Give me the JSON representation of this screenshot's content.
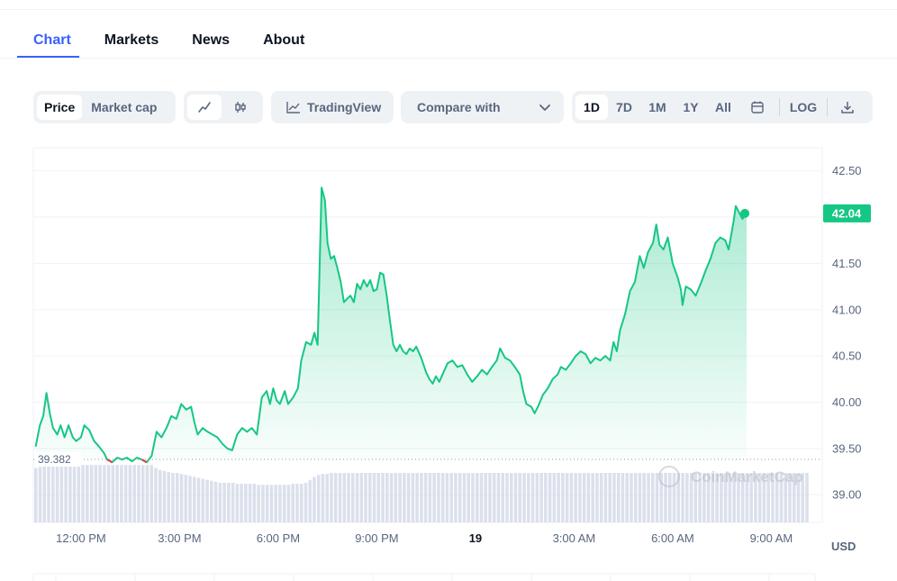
{
  "tabs": [
    {
      "label": "Chart",
      "active": true
    },
    {
      "label": "Markets",
      "active": false
    },
    {
      "label": "News",
      "active": false
    },
    {
      "label": "About",
      "active": false
    }
  ],
  "toolbar": {
    "type_toggle": [
      {
        "label": "Price",
        "active": true
      },
      {
        "label": "Market cap",
        "active": false
      }
    ],
    "chart_style": [
      {
        "icon": "line-chart-icon",
        "active": true
      },
      {
        "icon": "candlestick-icon",
        "active": false
      }
    ],
    "tradingview_label": "TradingView",
    "compare_label": "Compare with",
    "ranges": [
      {
        "label": "1D",
        "active": true
      },
      {
        "label": "7D",
        "active": false
      },
      {
        "label": "1M",
        "active": false
      },
      {
        "label": "1Y",
        "active": false
      },
      {
        "label": "All",
        "active": false
      }
    ],
    "calendar_icon": "calendar-icon",
    "log_label": "LOG",
    "download_icon": "download-icon"
  },
  "colors": {
    "accent": "#3861fb",
    "line_up": "#16c784",
    "line_down": "#ea3943",
    "volume": "#cfd6e4",
    "grid": "#eff2f5"
  },
  "chart_data": {
    "type": "area",
    "currency": "USD",
    "current_price_label": "42.04",
    "baseline_label": "39.382",
    "watermark": "CoinMarketCap",
    "y_ticks": [
      "42.50",
      "42.00",
      "41.50",
      "41.00",
      "40.50",
      "40.00",
      "39.50",
      "39.00"
    ],
    "x_ticks": [
      {
        "label": "12:00 PM",
        "h": 0,
        "bold": false
      },
      {
        "label": "3:00 PM",
        "h": 3,
        "bold": false
      },
      {
        "label": "6:00 PM",
        "h": 6,
        "bold": false
      },
      {
        "label": "9:00 PM",
        "h": 9,
        "bold": false
      },
      {
        "label": "19",
        "h": 12,
        "bold": true
      },
      {
        "label": "3:00 AM",
        "h": 15,
        "bold": false
      },
      {
        "label": "6:00 AM",
        "h": 18,
        "bold": false
      },
      {
        "label": "9:00 AM",
        "h": 21,
        "bold": false
      }
    ],
    "ylim": [
      38.7,
      42.75
    ],
    "xlim": [
      -1.45,
      22.55
    ],
    "baseline": 39.382,
    "series": [
      {
        "points": [
          [
            -1.38,
            39.52
          ],
          [
            -1.25,
            39.75
          ],
          [
            -1.15,
            39.85
          ],
          [
            -1.05,
            40.1
          ],
          [
            -0.95,
            39.88
          ],
          [
            -0.85,
            39.72
          ],
          [
            -0.72,
            39.65
          ],
          [
            -0.62,
            39.75
          ],
          [
            -0.5,
            39.62
          ],
          [
            -0.38,
            39.75
          ],
          [
            -0.25,
            39.62
          ],
          [
            -0.15,
            39.58
          ],
          [
            0.0,
            39.62
          ],
          [
            0.1,
            39.75
          ],
          [
            0.25,
            39.7
          ],
          [
            0.4,
            39.58
          ],
          [
            0.55,
            39.52
          ],
          [
            0.7,
            39.45
          ],
          [
            0.8,
            39.38
          ],
          [
            0.95,
            39.35
          ],
          [
            1.1,
            39.4
          ],
          [
            1.25,
            39.38
          ],
          [
            1.4,
            39.4
          ],
          [
            1.55,
            39.36
          ],
          [
            1.7,
            39.4
          ],
          [
            1.85,
            39.38
          ],
          [
            2.0,
            39.35
          ],
          [
            2.15,
            39.42
          ],
          [
            2.3,
            39.68
          ],
          [
            2.45,
            39.62
          ],
          [
            2.6,
            39.72
          ],
          [
            2.75,
            39.85
          ],
          [
            2.9,
            39.82
          ],
          [
            3.05,
            39.98
          ],
          [
            3.2,
            39.92
          ],
          [
            3.35,
            39.95
          ],
          [
            3.45,
            39.78
          ],
          [
            3.55,
            39.65
          ],
          [
            3.7,
            39.72
          ],
          [
            3.85,
            39.68
          ],
          [
            4.0,
            39.65
          ],
          [
            4.15,
            39.62
          ],
          [
            4.3,
            39.55
          ],
          [
            4.45,
            39.5
          ],
          [
            4.6,
            39.48
          ],
          [
            4.75,
            39.65
          ],
          [
            4.9,
            39.72
          ],
          [
            5.05,
            39.68
          ],
          [
            5.2,
            39.72
          ],
          [
            5.35,
            39.65
          ],
          [
            5.5,
            40.05
          ],
          [
            5.65,
            40.12
          ],
          [
            5.75,
            39.98
          ],
          [
            5.85,
            40.15
          ],
          [
            5.95,
            40.02
          ],
          [
            6.05,
            39.98
          ],
          [
            6.2,
            40.12
          ],
          [
            6.3,
            39.98
          ],
          [
            6.45,
            40.05
          ],
          [
            6.6,
            40.15
          ],
          [
            6.7,
            40.45
          ],
          [
            6.85,
            40.65
          ],
          [
            7.0,
            40.62
          ],
          [
            7.1,
            40.75
          ],
          [
            7.2,
            40.62
          ],
          [
            7.32,
            42.32
          ],
          [
            7.42,
            42.18
          ],
          [
            7.5,
            41.72
          ],
          [
            7.6,
            41.55
          ],
          [
            7.7,
            41.58
          ],
          [
            7.8,
            41.45
          ],
          [
            7.9,
            41.3
          ],
          [
            8.0,
            41.08
          ],
          [
            8.1,
            41.12
          ],
          [
            8.2,
            41.15
          ],
          [
            8.3,
            41.08
          ],
          [
            8.4,
            41.28
          ],
          [
            8.5,
            41.22
          ],
          [
            8.6,
            41.32
          ],
          [
            8.7,
            41.25
          ],
          [
            8.8,
            41.32
          ],
          [
            8.9,
            41.2
          ],
          [
            9.0,
            41.22
          ],
          [
            9.1,
            41.4
          ],
          [
            9.2,
            41.38
          ],
          [
            9.3,
            41.15
          ],
          [
            9.4,
            40.88
          ],
          [
            9.5,
            40.62
          ],
          [
            9.6,
            40.55
          ],
          [
            9.7,
            40.62
          ],
          [
            9.8,
            40.55
          ],
          [
            9.9,
            40.52
          ],
          [
            10.0,
            40.58
          ],
          [
            10.1,
            40.55
          ],
          [
            10.2,
            40.6
          ],
          [
            10.35,
            40.48
          ],
          [
            10.5,
            40.32
          ],
          [
            10.6,
            40.25
          ],
          [
            10.7,
            40.2
          ],
          [
            10.8,
            40.28
          ],
          [
            10.9,
            40.22
          ],
          [
            11.0,
            40.3
          ],
          [
            11.15,
            40.42
          ],
          [
            11.3,
            40.45
          ],
          [
            11.45,
            40.38
          ],
          [
            11.6,
            40.4
          ],
          [
            11.75,
            40.3
          ],
          [
            11.9,
            40.22
          ],
          [
            12.05,
            40.28
          ],
          [
            12.2,
            40.35
          ],
          [
            12.35,
            40.3
          ],
          [
            12.5,
            40.38
          ],
          [
            12.65,
            40.45
          ],
          [
            12.75,
            40.58
          ],
          [
            12.9,
            40.48
          ],
          [
            13.05,
            40.45
          ],
          [
            13.2,
            40.38
          ],
          [
            13.35,
            40.3
          ],
          [
            13.45,
            40.12
          ],
          [
            13.55,
            39.98
          ],
          [
            13.7,
            39.95
          ],
          [
            13.8,
            39.88
          ],
          [
            13.9,
            39.95
          ],
          [
            14.05,
            40.08
          ],
          [
            14.2,
            40.15
          ],
          [
            14.35,
            40.25
          ],
          [
            14.5,
            40.3
          ],
          [
            14.6,
            40.38
          ],
          [
            14.75,
            40.35
          ],
          [
            14.9,
            40.42
          ],
          [
            15.05,
            40.5
          ],
          [
            15.2,
            40.55
          ],
          [
            15.35,
            40.52
          ],
          [
            15.5,
            40.42
          ],
          [
            15.65,
            40.48
          ],
          [
            15.8,
            40.45
          ],
          [
            15.95,
            40.5
          ],
          [
            16.1,
            40.45
          ],
          [
            16.2,
            40.65
          ],
          [
            16.3,
            40.55
          ],
          [
            16.4,
            40.78
          ],
          [
            16.55,
            40.95
          ],
          [
            16.7,
            41.2
          ],
          [
            16.85,
            41.3
          ],
          [
            17.0,
            41.58
          ],
          [
            17.12,
            41.45
          ],
          [
            17.25,
            41.62
          ],
          [
            17.4,
            41.72
          ],
          [
            17.5,
            41.92
          ],
          [
            17.6,
            41.7
          ],
          [
            17.72,
            41.65
          ],
          [
            17.85,
            41.78
          ],
          [
            18.0,
            41.5
          ],
          [
            18.15,
            41.35
          ],
          [
            18.25,
            41.22
          ],
          [
            18.3,
            41.05
          ],
          [
            18.4,
            41.25
          ],
          [
            18.55,
            41.22
          ],
          [
            18.7,
            41.15
          ],
          [
            18.85,
            41.28
          ],
          [
            19.0,
            41.42
          ],
          [
            19.15,
            41.55
          ],
          [
            19.3,
            41.72
          ],
          [
            19.45,
            41.78
          ],
          [
            19.6,
            41.75
          ],
          [
            19.7,
            41.65
          ],
          [
            19.85,
            41.95
          ],
          [
            19.92,
            42.12
          ],
          [
            20.02,
            42.05
          ],
          [
            20.12,
            41.98
          ],
          [
            20.25,
            42.04
          ]
        ],
        "volume": [
          0.55,
          0.56,
          0.57,
          0.57,
          0.58,
          0.58,
          0.58,
          0.58,
          0.58,
          0.58,
          0.58,
          0.58,
          0.58,
          0.58,
          0.58,
          0.58,
          0.58,
          0.58,
          0.58,
          0.58,
          0.58,
          0.58,
          0.58,
          0.58,
          0.58,
          0.58,
          0.58,
          0.58,
          0.55,
          0.53,
          0.52,
          0.51,
          0.5,
          0.5,
          0.49,
          0.48,
          0.47,
          0.46,
          0.45,
          0.44,
          0.43,
          0.42,
          0.41,
          0.4,
          0.4,
          0.4,
          0.4,
          0.39,
          0.39,
          0.39,
          0.39,
          0.39,
          0.38,
          0.38,
          0.38,
          0.38,
          0.38,
          0.38,
          0.38,
          0.38,
          0.39,
          0.39,
          0.39,
          0.4,
          0.43,
          0.46,
          0.48,
          0.49,
          0.49,
          0.5,
          0.5,
          0.5,
          0.5,
          0.5,
          0.5,
          0.5,
          0.5,
          0.5,
          0.5,
          0.5,
          0.5,
          0.5,
          0.5,
          0.5,
          0.5,
          0.5,
          0.5,
          0.5,
          0.5,
          0.5,
          0.5,
          0.5,
          0.5,
          0.5,
          0.5,
          0.5,
          0.5,
          0.5,
          0.5,
          0.5,
          0.5,
          0.5,
          0.5,
          0.5,
          0.5,
          0.5,
          0.5,
          0.5,
          0.5,
          0.5,
          0.5,
          0.5,
          0.5,
          0.5,
          0.5,
          0.5,
          0.5,
          0.5,
          0.5,
          0.5,
          0.5,
          0.5,
          0.5,
          0.5,
          0.5,
          0.5,
          0.5,
          0.5,
          0.5,
          0.5,
          0.5,
          0.5,
          0.5,
          0.5,
          0.5,
          0.5,
          0.5,
          0.5,
          0.5,
          0.5,
          0.5,
          0.5,
          0.5,
          0.5,
          0.5,
          0.5,
          0.5,
          0.5,
          0.5,
          0.5,
          0.5,
          0.5,
          0.5,
          0.5,
          0.5,
          0.5,
          0.5,
          0.5,
          0.5,
          0.5,
          0.5,
          0.5,
          0.5,
          0.5,
          0.5,
          0.5,
          0.5,
          0.5,
          0.5,
          0.5,
          0.5,
          0.5,
          0.5,
          0.5,
          0.5,
          0.5,
          0.5,
          0.5,
          0.5,
          0.5,
          0.5
        ]
      }
    ]
  }
}
